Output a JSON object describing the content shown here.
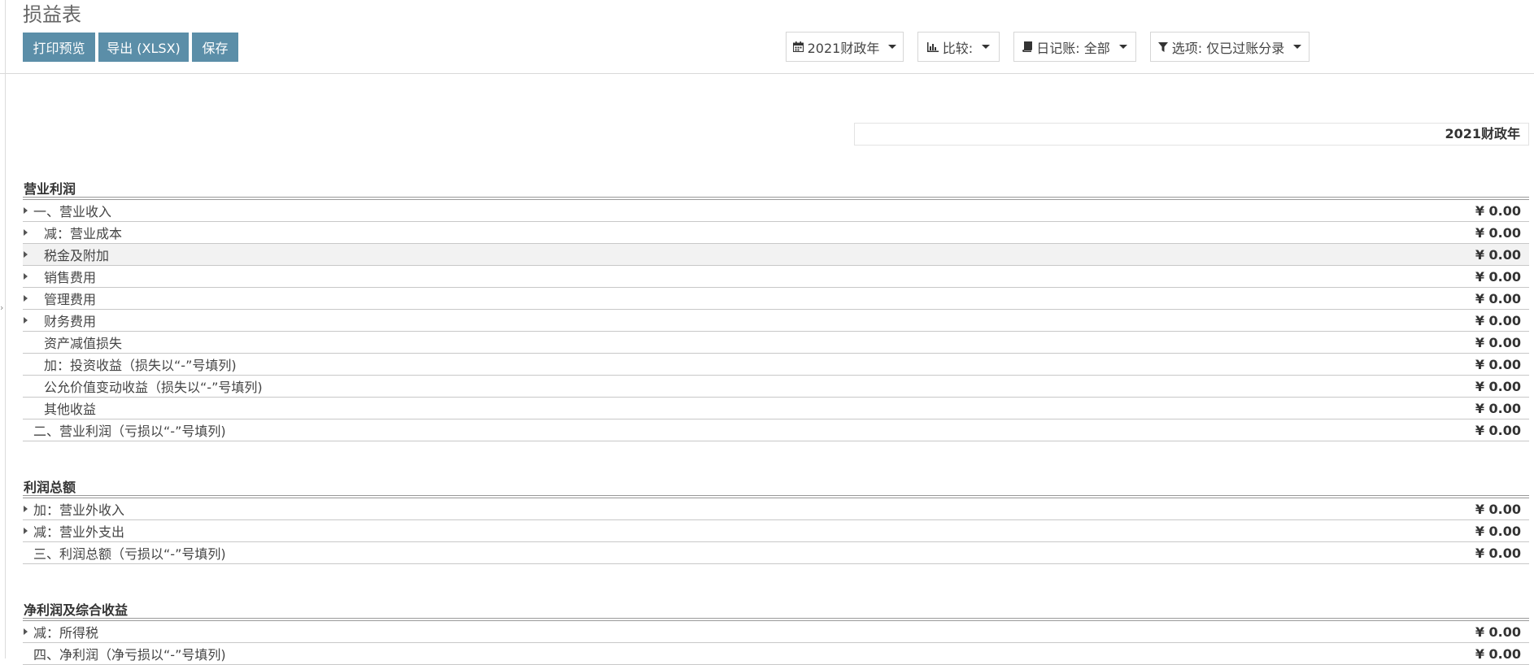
{
  "title": "损益表",
  "toolbar": {
    "print_label": "打印预览",
    "export_label": "导出 (XLSX)",
    "save_label": "保存"
  },
  "filters": {
    "period": "2021财政年",
    "compare": "比较:",
    "journals": "日记账: 全部",
    "options": "选项: 仅已过账分录"
  },
  "icons": {
    "period": "calendar-icon",
    "compare": "bar-chart-icon",
    "journals": "book-icon",
    "options": "filter-icon"
  },
  "column_header": "2021财政年",
  "sections": [
    {
      "title": "营业利润",
      "rows": [
        {
          "label": "一、营业收入",
          "amount": "¥ 0.00"
        },
        {
          "label": "减：营业成本",
          "amount": "¥ 0.00"
        },
        {
          "label": "税金及附加",
          "amount": "¥ 0.00"
        },
        {
          "label": "销售费用",
          "amount": "¥ 0.00"
        },
        {
          "label": "管理费用",
          "amount": "¥ 0.00"
        },
        {
          "label": "财务费用",
          "amount": "¥ 0.00"
        },
        {
          "label": "资产减值损失",
          "amount": "¥ 0.00"
        },
        {
          "label": "加：投资收益（损失以“-”号填列)",
          "amount": "¥ 0.00"
        },
        {
          "label": "公允价值变动收益（损失以“-”号填列)",
          "amount": "¥ 0.00"
        },
        {
          "label": "其他收益",
          "amount": "¥ 0.00"
        },
        {
          "label": "二、营业利润（亏损以“-”号填列)",
          "amount": "¥ 0.00"
        }
      ]
    },
    {
      "title": "利润总额",
      "rows": [
        {
          "label": "加：营业外收入",
          "amount": "¥ 0.00"
        },
        {
          "label": "减：营业外支出",
          "amount": "¥ 0.00"
        },
        {
          "label": "三、利润总额（亏损以“-”号填列)",
          "amount": "¥ 0.00"
        }
      ]
    },
    {
      "title": "净利润及综合收益",
      "rows": [
        {
          "label": "减：所得税",
          "amount": "¥ 0.00"
        },
        {
          "label": "四、净利润（净亏损以“-”号填列)",
          "amount": "¥ 0.00"
        }
      ]
    }
  ]
}
